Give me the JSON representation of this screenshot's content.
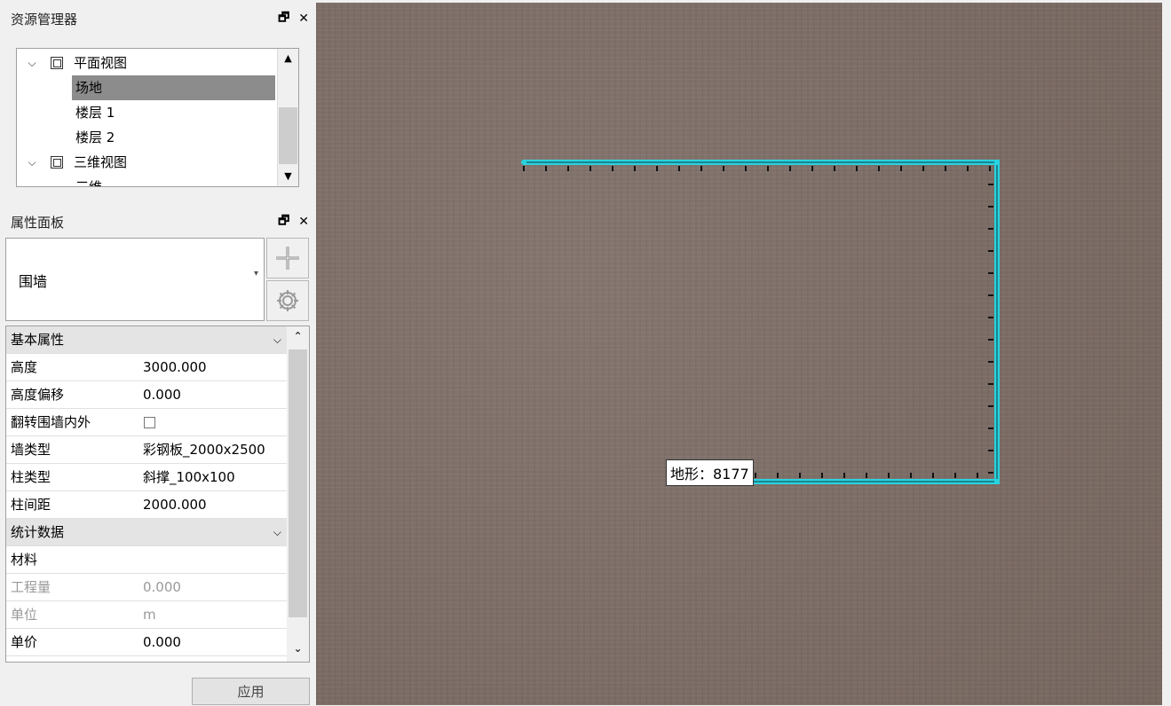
{
  "resource_panel": {
    "title": "资源管理器",
    "float_icon": "🗗",
    "close_icon": "✕",
    "tree": [
      {
        "label": "平面视图",
        "kind": "group",
        "expanded": true,
        "icon": "plan-view-icon"
      },
      {
        "label": "场地",
        "kind": "item",
        "selected": true
      },
      {
        "label": "楼层 1",
        "kind": "item"
      },
      {
        "label": "楼层 2",
        "kind": "item"
      },
      {
        "label": "三维视图",
        "kind": "group",
        "expanded": true,
        "icon": "3d-view-icon"
      },
      {
        "label": "三维",
        "kind": "item",
        "partially_visible": true
      }
    ]
  },
  "property_panel": {
    "title": "属性面板",
    "float_icon": "🗗",
    "close_icon": "✕",
    "type_value": "围墙",
    "add_icon": "plus-icon",
    "settings_icon": "gear-icon",
    "groups": [
      {
        "name": "基本属性",
        "rows": [
          {
            "key": "高度",
            "value": "3000.000"
          },
          {
            "key": "高度偏移",
            "value": "0.000"
          },
          {
            "key": "翻转围墙内外",
            "value": "",
            "checkbox": true,
            "checked": false
          },
          {
            "key": "墙类型",
            "value": "彩钢板_2000x2500"
          },
          {
            "key": "柱类型",
            "value": "斜撑_100x100"
          },
          {
            "key": "柱间距",
            "value": "2000.000"
          }
        ]
      },
      {
        "name": "统计数据",
        "rows": [
          {
            "key": "材料",
            "value": ""
          },
          {
            "key": "工程量",
            "value": "0.000",
            "disabled": true
          },
          {
            "key": "单位",
            "value": "m",
            "disabled": true
          },
          {
            "key": "单价",
            "value": "0.000"
          }
        ]
      }
    ],
    "apply_label": "应用"
  },
  "canvas": {
    "terrain_label": "地形：8177",
    "wall_color": "#29d3e0",
    "ground_color": "#7e6f68"
  }
}
